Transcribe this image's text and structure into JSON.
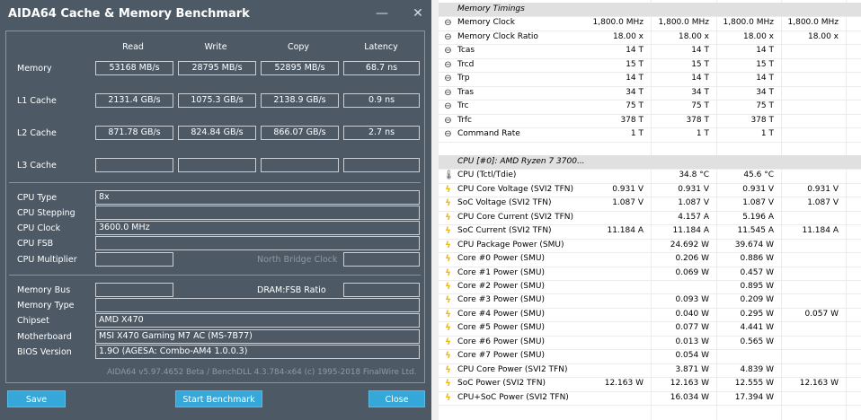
{
  "window": {
    "title": "AIDA64 Cache & Memory Benchmark",
    "minimize": "—",
    "close": "✕"
  },
  "headers": {
    "read": "Read",
    "write": "Write",
    "copy": "Copy",
    "latency": "Latency"
  },
  "bench": [
    {
      "label": "Memory",
      "read": "53168 MB/s",
      "write": "28795 MB/s",
      "copy": "52895 MB/s",
      "latency": "68.7 ns"
    },
    {
      "label": "L1 Cache",
      "read": "2131.4 GB/s",
      "write": "1075.3 GB/s",
      "copy": "2138.9 GB/s",
      "latency": "0.9 ns"
    },
    {
      "label": "L2 Cache",
      "read": "871.78 GB/s",
      "write": "824.84 GB/s",
      "copy": "866.07 GB/s",
      "latency": "2.7 ns"
    },
    {
      "label": "L3 Cache",
      "read": "",
      "write": "",
      "copy": "",
      "latency": ""
    }
  ],
  "cpu": {
    "type_label": "CPU Type",
    "type": "8x",
    "stepping_label": "CPU Stepping",
    "stepping": "",
    "clock_label": "CPU Clock",
    "clock": "3600.0 MHz",
    "fsb_label": "CPU FSB",
    "fsb": "",
    "mult_label": "CPU Multiplier",
    "mult": "",
    "nbclock_label": "North Bridge Clock",
    "nbclock": ""
  },
  "mem": {
    "bus_label": "Memory Bus",
    "bus": "",
    "ratio_label": "DRAM:FSB Ratio",
    "ratio": "",
    "type_label": "Memory Type",
    "type": "",
    "chipset_label": "Chipset",
    "chipset": "AMD X470",
    "mobo_label": "Motherboard",
    "mobo": "MSI X470 Gaming M7 AC (MS-7B77)",
    "bios_label": "BIOS Version",
    "bios": "1.9O  (AGESA: Combo-AM4 1.0.0.3)"
  },
  "footer": "AIDA64 v5.97.4652 Beta / BenchDLL 4.3.784-x64  (c) 1995-2018 FinalWire Ltd.",
  "buttons": {
    "save": "Save",
    "start": "Start Benchmark",
    "close": "Close"
  },
  "hwinfo": [
    {
      "type": "sec",
      "name": "Memory Timings"
    },
    {
      "icon": "clock",
      "name": "Memory Clock",
      "v": [
        "1,800.0 MHz",
        "1,800.0 MHz",
        "1,800.0 MHz",
        "1,800.0 MHz"
      ]
    },
    {
      "icon": "clock",
      "name": "Memory Clock Ratio",
      "v": [
        "18.00 x",
        "18.00 x",
        "18.00 x",
        "18.00 x"
      ]
    },
    {
      "icon": "clock",
      "name": "Tcas",
      "v": [
        "14 T",
        "14 T",
        "14 T",
        ""
      ]
    },
    {
      "icon": "clock",
      "name": "Trcd",
      "v": [
        "15 T",
        "15 T",
        "15 T",
        ""
      ]
    },
    {
      "icon": "clock",
      "name": "Trp",
      "v": [
        "14 T",
        "14 T",
        "14 T",
        ""
      ]
    },
    {
      "icon": "clock",
      "name": "Tras",
      "v": [
        "34 T",
        "34 T",
        "34 T",
        ""
      ]
    },
    {
      "icon": "clock",
      "name": "Trc",
      "v": [
        "75 T",
        "75 T",
        "75 T",
        ""
      ]
    },
    {
      "icon": "clock",
      "name": "Trfc",
      "v": [
        "378 T",
        "378 T",
        "378 T",
        ""
      ]
    },
    {
      "icon": "clock",
      "name": "Command Rate",
      "v": [
        "1 T",
        "1 T",
        "1 T",
        ""
      ]
    },
    {
      "type": "blank"
    },
    {
      "type": "sec",
      "name": "CPU [#0]: AMD Ryzen 7 3700..."
    },
    {
      "icon": "therm",
      "name": "CPU (Tctl/Tdie)",
      "v": [
        "",
        "34.8 °C",
        "45.6 °C",
        ""
      ]
    },
    {
      "icon": "bolt",
      "name": "CPU Core Voltage (SVI2 TFN)",
      "v": [
        "0.931 V",
        "0.931 V",
        "0.931 V",
        "0.931 V"
      ]
    },
    {
      "icon": "bolt",
      "name": "SoC Voltage (SVI2 TFN)",
      "v": [
        "1.087 V",
        "1.087 V",
        "1.087 V",
        "1.087 V"
      ]
    },
    {
      "icon": "bolt",
      "name": "CPU Core Current (SVI2 TFN)",
      "v": [
        "",
        "4.157 A",
        "5.196 A",
        ""
      ]
    },
    {
      "icon": "bolt",
      "name": "SoC Current (SVI2 TFN)",
      "v": [
        "11.184 A",
        "11.184 A",
        "11.545 A",
        "11.184 A"
      ]
    },
    {
      "icon": "bolt",
      "name": "CPU Package Power (SMU)",
      "v": [
        "",
        "24.692 W",
        "39.674 W",
        ""
      ]
    },
    {
      "icon": "bolt",
      "name": "Core #0 Power (SMU)",
      "v": [
        "",
        "0.206 W",
        "0.886 W",
        ""
      ]
    },
    {
      "icon": "bolt",
      "name": "Core #1 Power (SMU)",
      "v": [
        "",
        "0.069 W",
        "0.457 W",
        ""
      ]
    },
    {
      "icon": "bolt",
      "name": "Core #2 Power (SMU)",
      "v": [
        "",
        "",
        "0.895 W",
        ""
      ]
    },
    {
      "icon": "bolt",
      "name": "Core #3 Power (SMU)",
      "v": [
        "",
        "0.093 W",
        "0.209 W",
        ""
      ]
    },
    {
      "icon": "bolt",
      "name": "Core #4 Power (SMU)",
      "v": [
        "",
        "0.040 W",
        "0.295 W",
        "0.057 W"
      ]
    },
    {
      "icon": "bolt",
      "name": "Core #5 Power (SMU)",
      "v": [
        "",
        "0.077 W",
        "4.441 W",
        ""
      ]
    },
    {
      "icon": "bolt",
      "name": "Core #6 Power (SMU)",
      "v": [
        "",
        "0.013 W",
        "0.565 W",
        ""
      ]
    },
    {
      "icon": "bolt",
      "name": "Core #7 Power (SMU)",
      "v": [
        "",
        "0.054 W",
        "",
        ""
      ]
    },
    {
      "icon": "bolt",
      "name": "CPU Core Power (SVI2 TFN)",
      "v": [
        "",
        "3.871 W",
        "4.839 W",
        ""
      ]
    },
    {
      "icon": "bolt",
      "name": "SoC Power (SVI2 TFN)",
      "v": [
        "12.163 W",
        "12.163 W",
        "12.555 W",
        "12.163 W"
      ]
    },
    {
      "icon": "bolt",
      "name": "CPU+SoC Power (SVI2 TFN)",
      "v": [
        "",
        "16.034 W",
        "17.394 W",
        ""
      ]
    }
  ],
  "colors": {
    "aida_bg": "#4d5a66",
    "button": "#36a7d9",
    "section_bg": "#e0e0e0",
    "bolt": "#f2b500"
  }
}
